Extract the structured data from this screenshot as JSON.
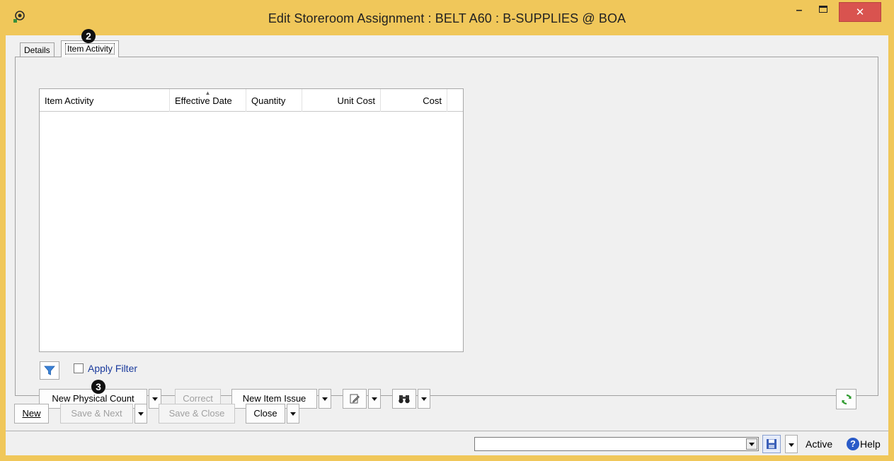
{
  "window": {
    "title": "Edit Storeroom Assignment : BELT A60 : B-SUPPLIES @ BOA",
    "minimize_glyph": "–",
    "close_glyph": "✕"
  },
  "tabs": [
    {
      "label": "Details",
      "active": false
    },
    {
      "label": "Item Activity",
      "active": true
    }
  ],
  "markers": {
    "tab_marker": "2",
    "button_marker": "3"
  },
  "grid": {
    "columns": [
      {
        "label": "Item Activity"
      },
      {
        "label": "Effective Date",
        "sorted": "ascending"
      },
      {
        "label": "Quantity"
      },
      {
        "label": "Unit Cost"
      },
      {
        "label": "Cost"
      }
    ],
    "rows": [],
    "sort_glyph": "▲"
  },
  "filter": {
    "icon": "funnel-icon",
    "checkbox_checked": false,
    "label": "Apply Filter"
  },
  "actions": {
    "new_physical_count": "New Physical Count",
    "correct": "Correct",
    "new_item_issue": "New Item Issue",
    "edit_icon": "edit-document-icon",
    "find_icon": "binoculars-icon",
    "refresh_icon": "refresh-icon"
  },
  "footer_buttons": {
    "new": "New",
    "save_next": "Save & Next",
    "save_close": "Save & Close",
    "close": "Close"
  },
  "status_bar": {
    "combo_value": "",
    "status": "Active",
    "help_glyph": "?",
    "help": "Help"
  },
  "colors": {
    "titlebar": "#f0c75a",
    "close_button": "#d9534f",
    "link_text": "#1a3a9c",
    "accent_green": "#2e9a2e"
  }
}
